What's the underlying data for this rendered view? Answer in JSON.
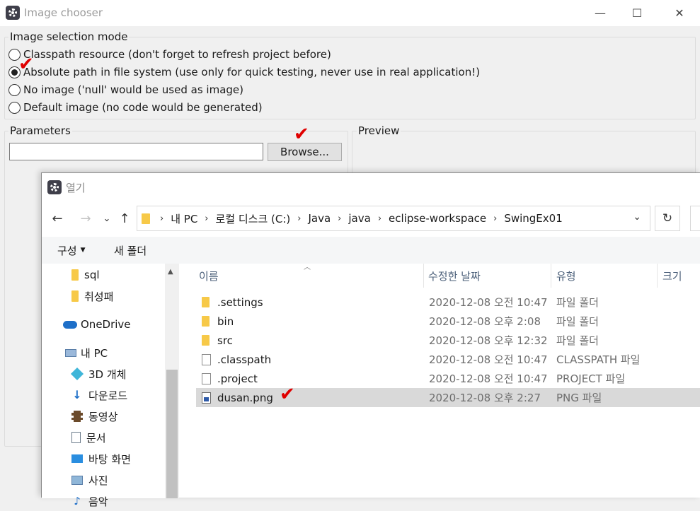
{
  "chooser": {
    "title": "Image chooser",
    "mode_group_label": "Image selection mode",
    "modes": [
      {
        "label": "Classpath resource (don't forget to refresh project before)",
        "checked": false
      },
      {
        "label": "Absolute path in file system (use only for quick testing, never use in real application!)",
        "checked": true
      },
      {
        "label": "No image ('null' would be used as image)",
        "checked": false
      },
      {
        "label": "Default image (no code would be generated)",
        "checked": false
      }
    ],
    "parameters_label": "Parameters",
    "path_value": "",
    "browse_label": "Browse...",
    "preview_label": "Preview",
    "window_controls": {
      "minimize": "—",
      "maximize": "☐",
      "close": "✕"
    }
  },
  "dialog": {
    "title": "열기",
    "breadcrumb": [
      "내 PC",
      "로컬 디스크 (C:)",
      "Java",
      "java",
      "eclipse-workspace",
      "SwingEx01"
    ],
    "commands": {
      "organize": "구성",
      "new_folder": "새 폴더"
    },
    "nav_items": [
      {
        "label": "sql",
        "icon": "folder-icon"
      },
      {
        "label": "취성패",
        "icon": "folder-icon"
      },
      {
        "label": "OneDrive",
        "icon": "cloud-icon"
      },
      {
        "label": "내 PC",
        "icon": "computer-icon"
      },
      {
        "label": "3D 개체",
        "icon": "cube-icon"
      },
      {
        "label": "다운로드",
        "icon": "download-arrow-icon"
      },
      {
        "label": "동영상",
        "icon": "film-icon"
      },
      {
        "label": "문서",
        "icon": "document-icon"
      },
      {
        "label": "바탕 화면",
        "icon": "desktop-icon"
      },
      {
        "label": "사진",
        "icon": "picture-icon"
      },
      {
        "label": "음악",
        "icon": "music-icon"
      }
    ],
    "columns": {
      "name": "이름",
      "modified": "수정한 날짜",
      "type": "유형",
      "size": "크기"
    },
    "files": [
      {
        "name": ".settings",
        "modified": "2020-12-08 오전 10:47",
        "type": "파일 폴더",
        "icon": "folder-icon",
        "selected": false
      },
      {
        "name": "bin",
        "modified": "2020-12-08 오후 2:08",
        "type": "파일 폴더",
        "icon": "folder-icon",
        "selected": false
      },
      {
        "name": "src",
        "modified": "2020-12-08 오후 12:32",
        "type": "파일 폴더",
        "icon": "folder-icon",
        "selected": false
      },
      {
        "name": ".classpath",
        "modified": "2020-12-08 오전 10:47",
        "type": "CLASSPATH 파일",
        "icon": "file-icon",
        "selected": false
      },
      {
        "name": ".project",
        "modified": "2020-12-08 오전 10:47",
        "type": "PROJECT 파일",
        "icon": "file-icon",
        "selected": false
      },
      {
        "name": "dusan.png",
        "modified": "2020-12-08 오후 2:27",
        "type": "PNG 파일",
        "icon": "image-file-icon",
        "selected": true
      }
    ],
    "annotation_color": "#e00000",
    "selection_color": "#d9d9d9"
  }
}
